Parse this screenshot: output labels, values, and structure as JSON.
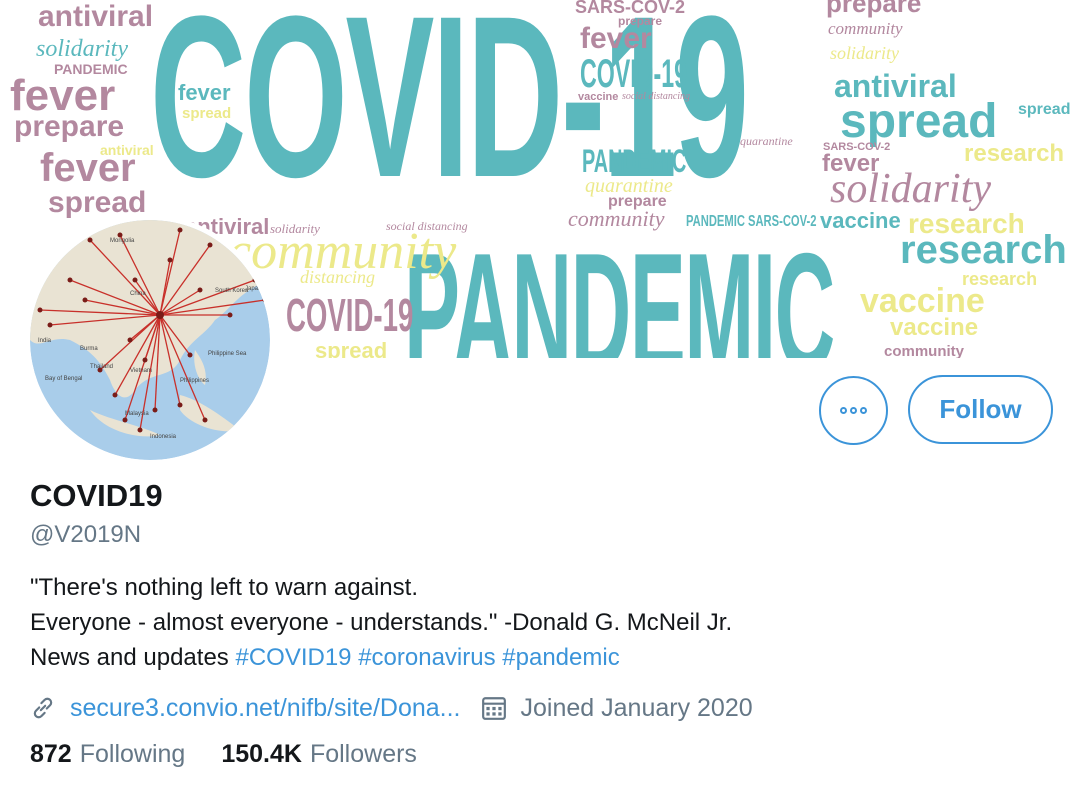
{
  "banner": {
    "words": [
      "antiviral",
      "solidarity",
      "PANDEMIC",
      "fever",
      "prepare",
      "antiviral",
      "fever",
      "spread",
      "COVID-19",
      "PANDEMIC",
      "fever",
      "spread",
      "SARS-COV-2",
      "prepare",
      "fever",
      "COVID-19",
      "vaccine",
      "social distancing",
      "PANDEMIC",
      "quarantine",
      "prepare",
      "community",
      "prepare",
      "community",
      "solidarity",
      "antiviral",
      "spread",
      "spread",
      "SARS-COV-2",
      "fever",
      "solidarity",
      "research",
      "vaccine",
      "research",
      "research",
      "vaccine",
      "vaccine",
      "research",
      "COVID-19",
      "community",
      "distancing",
      "spread",
      "antiviral",
      "solidarity",
      "community",
      "social distancing",
      "PANDEMIC",
      "SARS-COV-2",
      "quarantine"
    ]
  },
  "profile": {
    "name": "COVID19",
    "handle": "@V2019N",
    "bio_line1": "\"There's nothing left to warn against.",
    "bio_line2": "Everyone - almost everyone - understands.\" -Donald G. McNeil Jr.",
    "bio_line3_prefix": "News and updates ",
    "hashtags": [
      "#COVID19",
      "#coronavirus",
      "#pandemic"
    ],
    "link": "secure3.convio.net/nifb/site/Dona...",
    "joined": "Joined January 2020",
    "following_count": "872",
    "following_label": "Following",
    "followers_count": "150.4K",
    "followers_label": "Followers"
  },
  "actions": {
    "follow_label": "Follow"
  },
  "avatar_map_labels": [
    "Mongolia",
    "South Korea",
    "Japan",
    "China",
    "India",
    "Burma",
    "Thailand",
    "Vietnam",
    "Philippines",
    "Malaysia",
    "Indonesia",
    "Bay of Bengal",
    "Philippine Sea"
  ],
  "colors": {
    "accent": "#3b94d9",
    "teal": "#5bb8bd",
    "mauve": "#b3889f",
    "yellow": "#ece98a",
    "secondary_text": "#657786"
  },
  "icons": [
    "link-icon",
    "calendar-icon",
    "more-icon"
  ]
}
